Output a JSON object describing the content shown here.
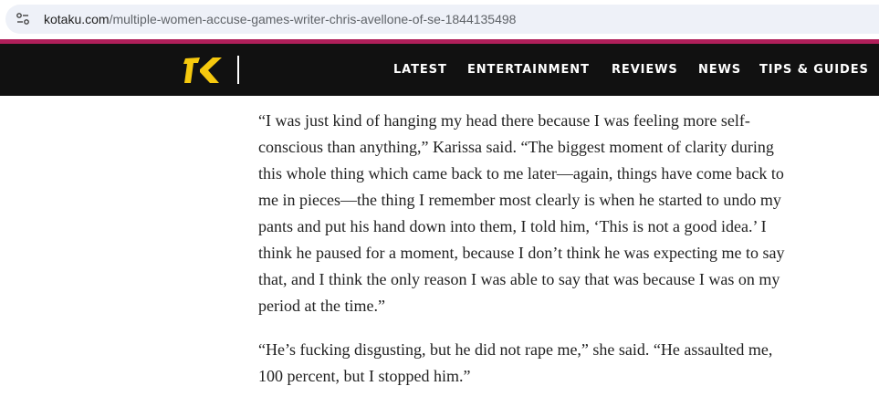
{
  "browser": {
    "url_domain": "kotaku.com",
    "url_path": "/multiple-women-accuse-games-writer-chris-avellone-of-se-1844135498",
    "site_info_icon": "tune-icon"
  },
  "header": {
    "logo_icon": "kotaku-k-logo",
    "accent_color": "#b01f5a",
    "logo_color": "#f6c90e",
    "nav": [
      {
        "label": "LATEST"
      },
      {
        "label": "ENTERTAINMENT"
      },
      {
        "label": "REVIEWS"
      },
      {
        "label": "NEWS"
      },
      {
        "label": "TIPS & GUIDES"
      }
    ]
  },
  "article": {
    "paragraphs": [
      {
        "lines": [
          "“I was just kind of hanging my head there because I was feeling more self-",
          "conscious than anything,” Karissa said. “The biggest moment of clarity during",
          "this whole thing which came back to me later—again, things have come back to",
          "me in pieces—the thing I remember most clearly is when he started to undo my",
          "pants and put his hand down into them, I told him, ‘This is not a good idea.’ I",
          "think he paused for a moment, because I don’t think he was expecting me to say",
          "that, and I think the only reason I was able to say that was because I was on my",
          "period at the time.”"
        ]
      },
      {
        "lines": [
          "“He’s fucking disgusting, but he did not rape me,” she said. “He assaulted me,",
          "100 percent, but I stopped him.”"
        ]
      }
    ]
  }
}
